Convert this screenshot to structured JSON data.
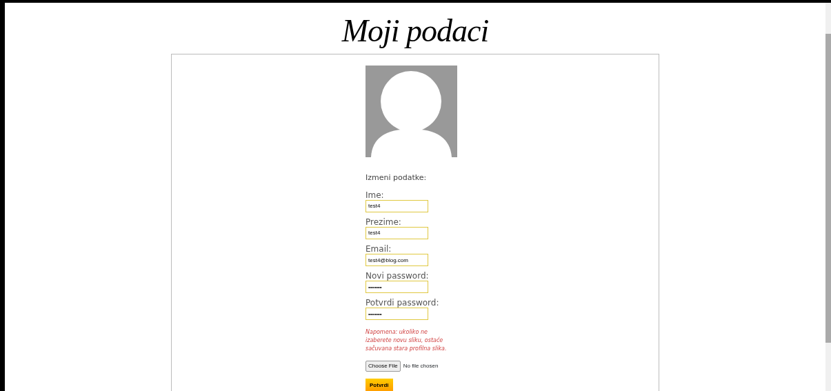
{
  "title": "Moji podaci",
  "form": {
    "heading": "Izmeni podatke:",
    "fields": [
      {
        "label": "Ime:",
        "value": "test4"
      },
      {
        "label": "Prezime:",
        "value": "test4"
      },
      {
        "label": "Email:",
        "value": "test4@blog.com"
      },
      {
        "label": "Novi password:",
        "value": "•••••••"
      },
      {
        "label": "Potvrdi password:",
        "value": "•••••••"
      }
    ],
    "note": "Napomena: ukoliko ne izaberete novu sliku, ostaće sačuvana stara profilna slika.",
    "file": {
      "button": "Choose File",
      "status": "No file chosen"
    },
    "submit": "Potvrdi"
  }
}
